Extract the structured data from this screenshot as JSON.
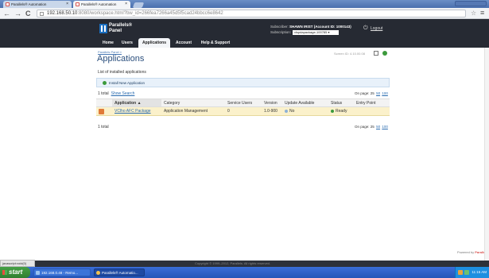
{
  "browser": {
    "tabs": [
      {
        "label": "Parallels® Automation",
        "active": false
      },
      {
        "label": "Parallels® Automation",
        "active": true
      }
    ],
    "nav": {
      "back": "←",
      "forward": "→",
      "reload": "C"
    },
    "url": {
      "host": "192.168.50.10",
      "rest": ":8080/workspace.html?bw_id=266fea7266a45d5f5cad24bbcc6e8642"
    },
    "star": "☆",
    "menu": "≡"
  },
  "header": {
    "logo_line1": "Parallels®",
    "logo_line2": "Panel",
    "account_prefix": "Subscriber:",
    "account_name": "SHAWN IRIST (Account ID: 1000143)",
    "subscription_label": "Subscription:",
    "subscription_value": "vlspdapackage-100785",
    "logout": "Logout",
    "nav_tabs": [
      "Home",
      "Users",
      "Applications",
      "Account",
      "Help & Support"
    ],
    "active_tab": "Applications"
  },
  "content": {
    "breadcrumb": "Parallels Panel »",
    "title": "Applications",
    "tools_text": "Screen ID: 4.10.00.08",
    "section_header": "List of installed applications",
    "install_label": "Install New Application",
    "total_top": "1 total",
    "show_search": "Show Search",
    "on_page_label": "On page:",
    "on_page_values": [
      "25",
      "50",
      "100"
    ],
    "table": {
      "columns": [
        "Application ▲",
        "Category",
        "Service Users",
        "Version",
        "Update Available",
        "Status",
        "Entry Point"
      ],
      "rows": [
        {
          "application": "VClho AFC Package",
          "category": "Application Management",
          "service_users": "0",
          "version": "1.0-900",
          "update": "No",
          "status": "Ready",
          "entry_point": ""
        }
      ]
    },
    "total_bottom": "1 total"
  },
  "footer": {
    "powered_by": "Powered by",
    "brand": "Parallels",
    "copyright": "Copyright © 1999–2012, Parallels. All rights reserved.",
    "status_link": "javascript:void(0)"
  },
  "taskbar": {
    "start": "start",
    "tasks": [
      "192.168.0.48 - Remo...",
      "Parallels® Automatio..."
    ],
    "clock": "11:15 AM"
  },
  "colors": {
    "header_bg": "#262a33",
    "accent": "#2a6cb0",
    "row_highlight": "#fbf1cb",
    "status_ready": "#3c9a3c",
    "status_no": "#8fb2d6"
  }
}
